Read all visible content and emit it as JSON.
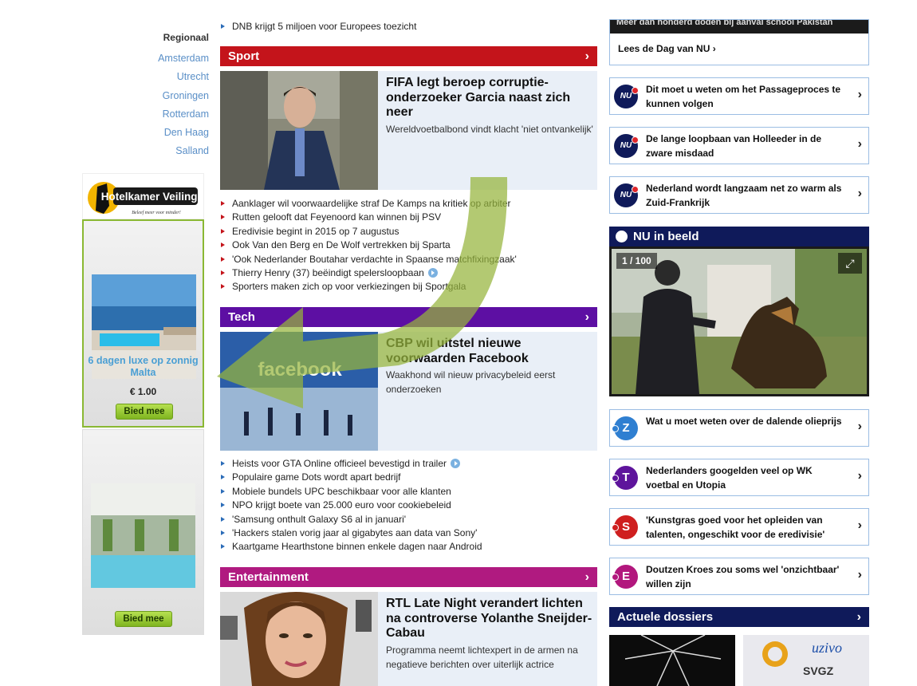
{
  "regional": {
    "title": "Regionaal",
    "links": [
      "Amsterdam",
      "Utrecht",
      "Groningen",
      "Rotterdam",
      "Den Haag",
      "Salland"
    ]
  },
  "ads": {
    "logo_text": "Hotelkamer Veiling.nl",
    "logo_tagline": "Beleef meer voor minder!",
    "ad1": {
      "caption": "6 dagen luxe op zonnig Malta",
      "price": "€ 1.00",
      "button": "Bied mee"
    },
    "ad2": {
      "button": "Bied mee"
    }
  },
  "top_bullet": "DNB krijgt 5 miljoen voor Europees toezicht",
  "sport": {
    "label": "Sport",
    "color": "#c4141b",
    "headline": "FIFA legt beroep corruptie-onderzoeker Garcia naast zich neer",
    "intro": "Wereldvoetbalbond vindt klacht 'niet ontvankelijk'",
    "items": [
      "Aanklager wil voorwaardelijke straf De Kamps na kritiek op arbiter",
      "Rutten gelooft dat Feyenoord kan winnen bij PSV",
      "Eredivisie begint in 2015 op 7 augustus",
      "Ook Van den Berg en De Wolf vertrekken bij Sparta",
      "'Ook Nederlander Boutahar verdachte in Spaanse matchfixingzaak'",
      "Thierry Henry (37) beëindigt spelersloopbaan",
      "Sporters maken zich op voor verkiezingen bij Sportgala"
    ]
  },
  "tech": {
    "label": "Tech",
    "color": "#5d0fa3",
    "image_text": "facebook",
    "headline": "CBP wil uitstel nieuwe voorwaarden Facebook",
    "intro": "Waakhond wil nieuw privacybeleid eerst onderzoeken",
    "items": [
      "Heists voor GTA Online officieel bevestigd in trailer",
      "Populaire game Dots wordt apart bedrijf",
      "Mobiele bundels UPC beschikbaar voor alle klanten",
      "NPO krijgt boete van 25.000 euro voor cookiebeleid",
      "'Samsung onthult Galaxy S6 al in januari'",
      "'Hackers stalen vorig jaar al gigabytes aan data van Sony'",
      "Kaartgame Hearthstone binnen enkele dagen naar Android"
    ]
  },
  "entertainment": {
    "label": "Entertainment",
    "color": "#b01a80",
    "headline": "RTL Late Night verandert lichten na controverse Yolanthe Sneijder-Cabau",
    "intro": "Programma neemt lichtexpert in de armen na negatieve berichten over uiterlijk actrice"
  },
  "right": {
    "top_dark_text": "Meer dan honderd doden bij aanval school Pakistan",
    "lees": "Lees de Dag van NU ›",
    "nu_icon": "NU",
    "nu_cards": [
      "Dit moet u weten om het Passageproces te kunnen volgen",
      "De lange loopbaan van Holleeder in de zware misdaad",
      "Nederland wordt langzaam net zo warm als Zuid-Frankrijk"
    ],
    "beeld": {
      "title": "NU in beeld",
      "counter": "1 / 100"
    },
    "letter_cards": [
      {
        "letter": "Z",
        "text": "Wat u moet weten over de dalende olieprijs"
      },
      {
        "letter": "T",
        "text": "Nederlanders googelden veel op WK voetbal en Utopia"
      },
      {
        "letter": "S",
        "text": "'Kunstgras goed voor het opleiden van talenten, ongeschikt voor de eredivisie'"
      },
      {
        "letter": "E",
        "text": "Doutzen Kroes zou soms wel 'onzichtbaar' willen zijn"
      }
    ],
    "dossiers": {
      "title": "Actuele dossiers",
      "logo2_text": "SVGZ",
      "logo2_brand": "uzivo"
    }
  },
  "chevron": "›"
}
